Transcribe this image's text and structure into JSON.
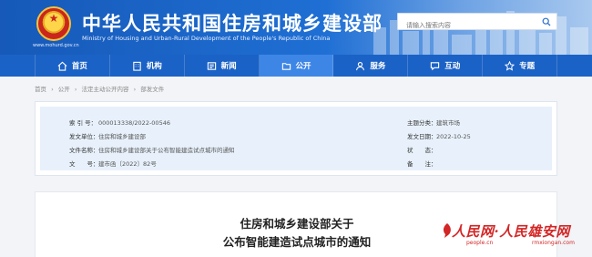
{
  "header": {
    "title": "中华人民共和国住房和城乡建设部",
    "subtitle": "Ministry of Housing and Urban-Rural Development of the People's Republic of China",
    "emblem_url": "www.mohurd.gov.cn",
    "search_placeholder": "请输入搜索内容",
    "colors": {
      "brand": "#1b62c6",
      "active": "#3e86e6"
    }
  },
  "nav": {
    "items": [
      {
        "label": "首页",
        "icon": "home-icon"
      },
      {
        "label": "机构",
        "icon": "building-icon"
      },
      {
        "label": "新闻",
        "icon": "news-icon"
      },
      {
        "label": "公开",
        "icon": "open-folder-icon",
        "active": true
      },
      {
        "label": "服务",
        "icon": "service-icon"
      },
      {
        "label": "互动",
        "icon": "chat-icon"
      },
      {
        "label": "专题",
        "icon": "topic-icon"
      }
    ]
  },
  "breadcrumb": [
    "首页",
    "›",
    "公开",
    "›",
    "法定主动公开内容",
    "›",
    "部发文件"
  ],
  "meta": {
    "index_no_label": "索 引 号：",
    "index_no": "000013338/2022-00546",
    "issuer_label": "发文单位：",
    "issuer": "住房和城乡建设部",
    "doc_name_label": "文件名称：",
    "doc_name": "住房和城乡建设部关于公布智能建造试点城市的通知",
    "doc_no_label": "文　　号：",
    "doc_no": "建市函〔2022〕82号",
    "topic_label": "主题分类：",
    "topic": "建筑市场",
    "date_label": "发文日期：",
    "date": "2022-10-25",
    "status_label": "状　　态：",
    "status": "",
    "remark_label": "备　　注：",
    "remark": ""
  },
  "article": {
    "title_line1": "住房和城乡建设部关于",
    "title_line2": "公布智能建造试点城市的通知"
  },
  "watermark": {
    "text": "人民网·人民雄安网",
    "url1": "people.cn",
    "url2": "rmxiongan.com"
  }
}
